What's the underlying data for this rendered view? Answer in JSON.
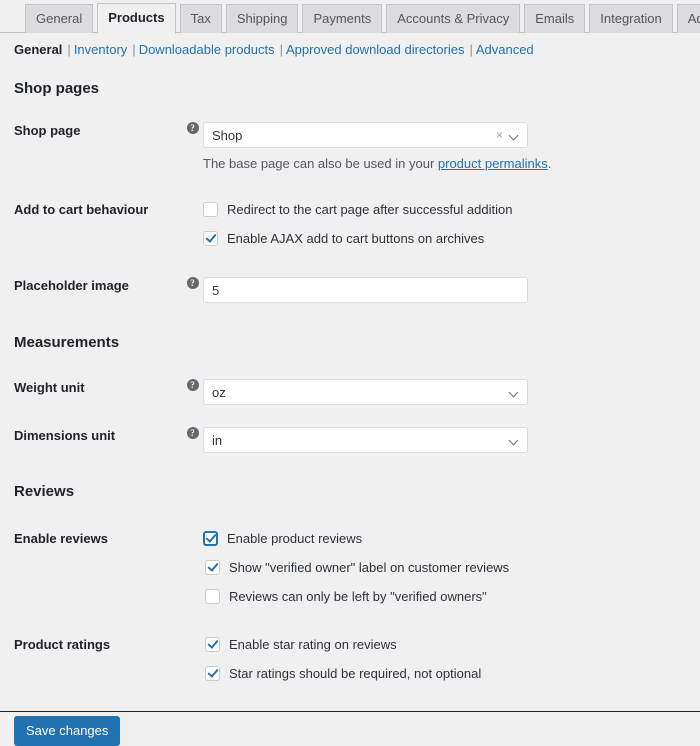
{
  "tabs": [
    {
      "label": "General",
      "active": false
    },
    {
      "label": "Products",
      "active": true
    },
    {
      "label": "Tax",
      "active": false
    },
    {
      "label": "Shipping",
      "active": false
    },
    {
      "label": "Payments",
      "active": false
    },
    {
      "label": "Accounts & Privacy",
      "active": false
    },
    {
      "label": "Emails",
      "active": false
    },
    {
      "label": "Integration",
      "active": false
    },
    {
      "label": "Advanced",
      "active": false
    }
  ],
  "subnav": {
    "items": [
      {
        "label": "General",
        "current": true
      },
      {
        "label": "Inventory",
        "current": false
      },
      {
        "label": "Downloadable products",
        "current": false
      },
      {
        "label": "Approved download directories",
        "current": false
      },
      {
        "label": "Advanced",
        "current": false
      }
    ],
    "separator": "|"
  },
  "sections": {
    "shop_pages": {
      "title": "Shop pages",
      "shop_page": {
        "label": "Shop page",
        "help_icon": "help-circle-icon",
        "value": "Shop",
        "clear_icon": "×",
        "dropdown_icon": "chevron-down-icon",
        "description_before": "The base page can also be used in your ",
        "description_link": "product permalinks",
        "description_after": "."
      },
      "add_to_cart": {
        "label": "Add to cart behaviour",
        "options": [
          {
            "label": "Redirect to the cart page after successful addition",
            "checked": false
          },
          {
            "label": "Enable AJAX add to cart buttons on archives",
            "checked": true
          }
        ]
      },
      "placeholder_image": {
        "label": "Placeholder image",
        "help_icon": "help-circle-icon",
        "value": "5",
        "placeholder": ""
      }
    },
    "measurements": {
      "title": "Measurements",
      "weight_unit": {
        "label": "Weight unit",
        "help_icon": "help-circle-icon",
        "value": "oz",
        "dropdown_icon": "chevron-down-icon"
      },
      "dimensions_unit": {
        "label": "Dimensions unit",
        "help_icon": "help-circle-icon",
        "value": "in",
        "dropdown_icon": "chevron-down-icon"
      }
    },
    "reviews": {
      "title": "Reviews",
      "enable_reviews": {
        "label": "Enable reviews",
        "options": [
          {
            "label": "Enable product reviews",
            "checked": true,
            "focused": true,
            "nested": false
          },
          {
            "label": "Show \"verified owner\" label on customer reviews",
            "checked": true,
            "focused": false,
            "nested": true
          },
          {
            "label": "Reviews can only be left by \"verified owners\"",
            "checked": false,
            "focused": false,
            "nested": true
          }
        ]
      },
      "product_ratings": {
        "label": "Product ratings",
        "options": [
          {
            "label": "Enable star rating on reviews",
            "checked": true,
            "nested": false
          },
          {
            "label": "Star ratings should be required, not optional",
            "checked": true,
            "nested": false
          }
        ]
      }
    }
  },
  "footer": {
    "save_label": "Save changes"
  },
  "colors": {
    "accent": "#2271b1",
    "page_background": "#f0f0f1",
    "tab_inactive": "#dcdcde",
    "text": "#1d2327",
    "muted_text": "#50575e"
  }
}
